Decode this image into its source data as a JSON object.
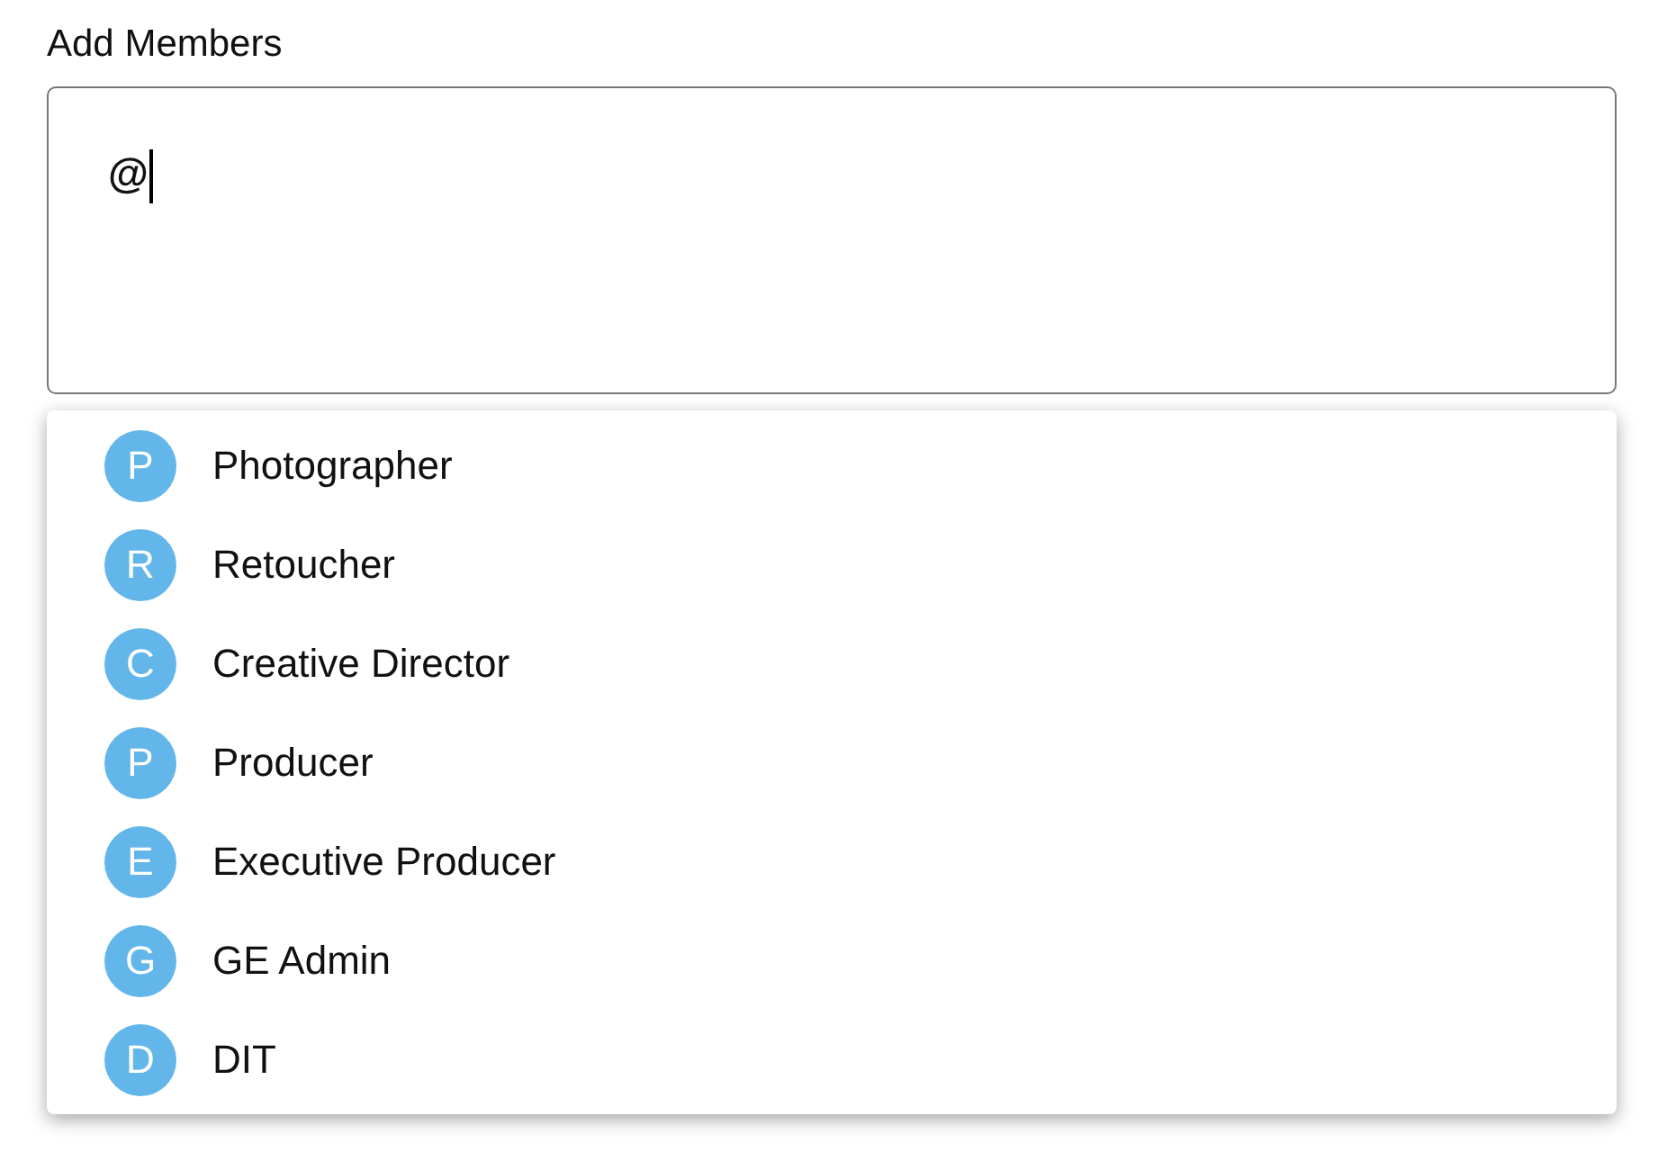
{
  "field_label": "Add Members",
  "input": {
    "value": "@"
  },
  "suggestions": [
    {
      "initial": "P",
      "name": "Photographer"
    },
    {
      "initial": "R",
      "name": "Retoucher"
    },
    {
      "initial": "C",
      "name": "Creative Director"
    },
    {
      "initial": "P",
      "name": "Producer"
    },
    {
      "initial": "E",
      "name": "Executive Producer"
    },
    {
      "initial": "G",
      "name": "GE Admin"
    },
    {
      "initial": "D",
      "name": "DIT"
    }
  ]
}
